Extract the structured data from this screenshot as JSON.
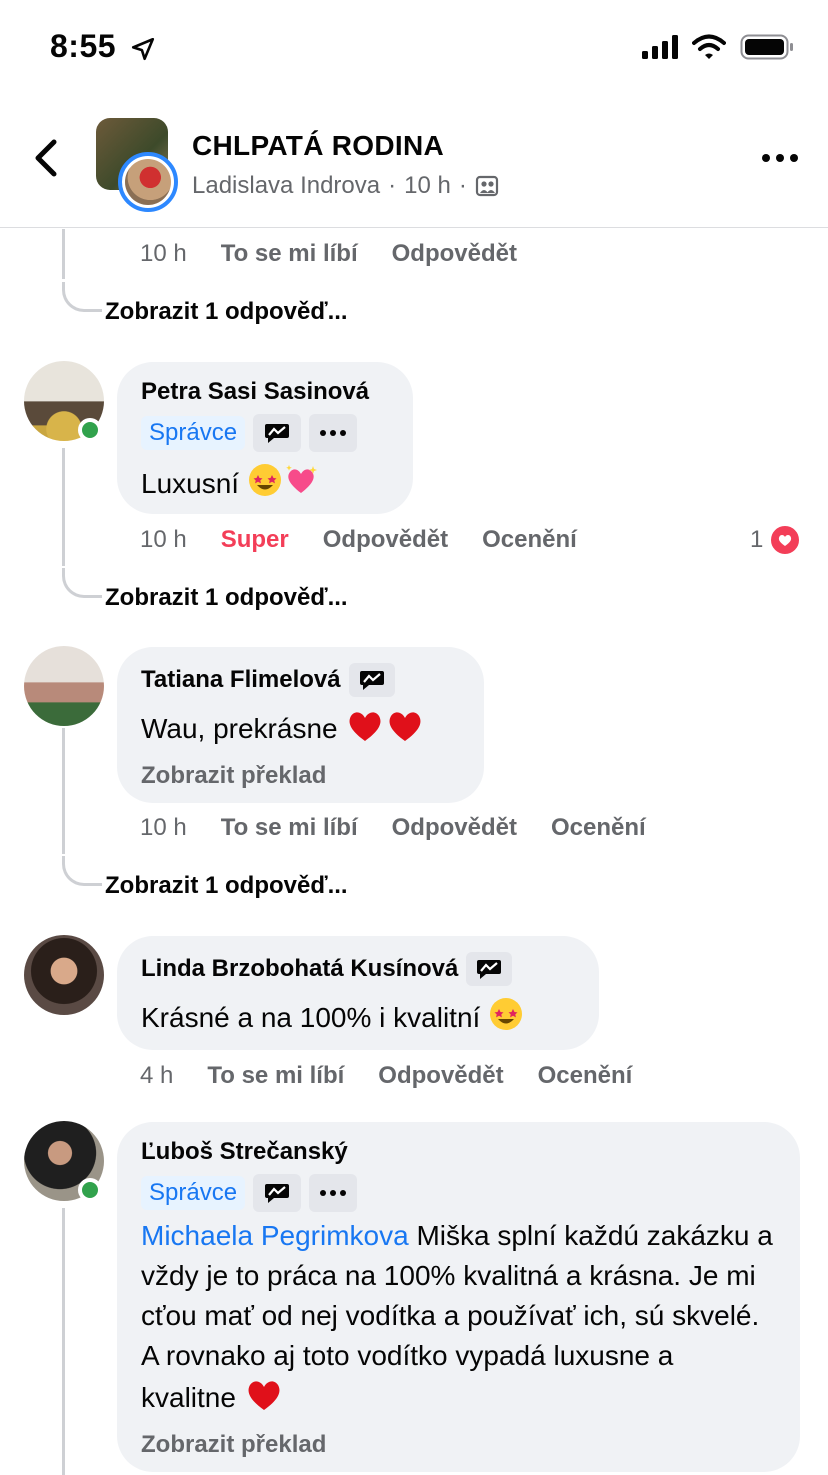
{
  "status_bar": {
    "time": "8:55"
  },
  "header": {
    "group_name": "CHLPATÁ RODINA",
    "author": "Ladislava Indrova",
    "time": "10 h",
    "separator": "·"
  },
  "top_meta": {
    "time": "10 h",
    "like": "To se mi líbí",
    "reply": "Odpovědět"
  },
  "show_replies_label": "Zobrazit 1 odpověď...",
  "comments": [
    {
      "author": "Petra Sasi Sasinová",
      "badge": "Správce",
      "text": "Luxusní",
      "meta": {
        "time": "10 h",
        "reaction": "Super",
        "reply": "Odpovědět",
        "award": "Ocenění"
      },
      "reaction_count": "1"
    },
    {
      "author": "Tatiana Flimelová",
      "text": "Wau, prekrásne",
      "translate": "Zobrazit překlad",
      "meta": {
        "time": "10 h",
        "like": "To se mi líbí",
        "reply": "Odpovědět",
        "award": "Ocenění"
      }
    },
    {
      "author": "Linda Brzobohatá Kusínová",
      "text": "Krásné a na 100% i kvalitní",
      "meta": {
        "time": "4 h",
        "like": "To se mi líbí",
        "reply": "Odpovědět",
        "award": "Ocenění"
      }
    },
    {
      "author": "Ľuboš Strečanský",
      "badge": "Správce",
      "mention": "Michaela Pegrimkova",
      "text": "Miška splní každú zakázku a vždy je to práca na 100% kvalitná a krásna. Je mi cťou mať od nej vodítka a používať ich, sú skvelé. A rovnako aj toto vodítko vypadá luxusne a kvalitne",
      "translate": "Zobrazit překlad"
    }
  ],
  "icons": {
    "status": [
      "location-arrow-icon",
      "signal-icon",
      "wifi-icon",
      "battery-icon"
    ],
    "header": [
      "back-chevron-icon",
      "group-avatar",
      "members-audience-icon",
      "more-options-icon"
    ],
    "badges": [
      "conversation-starter-icon",
      "more-dots-icon"
    ],
    "reactions": [
      "heart-reaction-icon"
    ]
  },
  "colors": {
    "link": "#1877f2",
    "super": "#f33e58",
    "online": "#31a24c",
    "bubble": "#f0f2f5",
    "meta": "#65676b"
  }
}
